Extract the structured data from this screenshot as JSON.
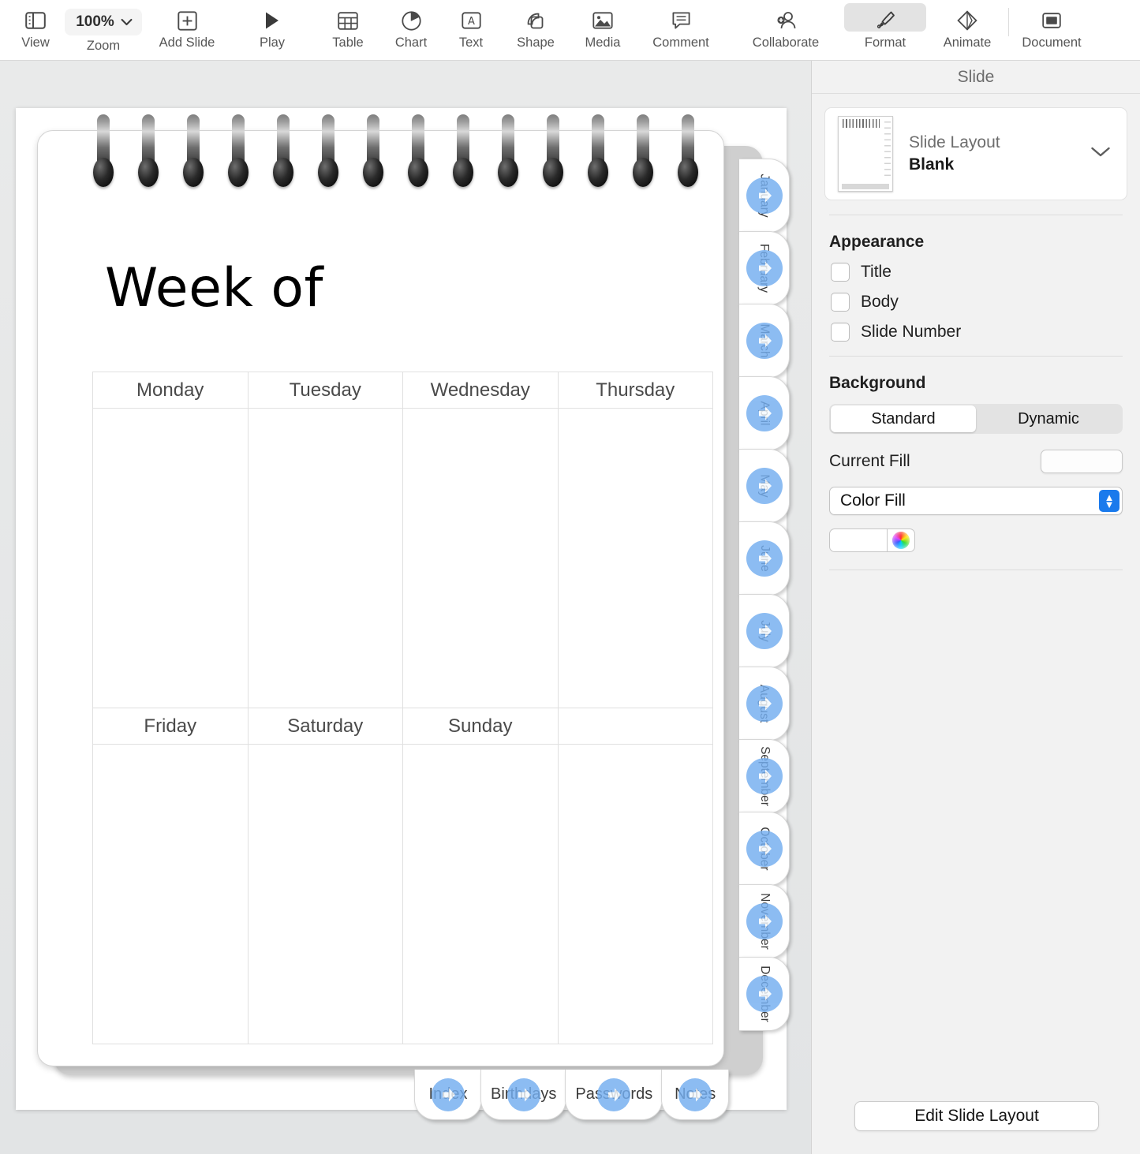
{
  "toolbar": {
    "items": [
      {
        "label": "View",
        "icon": "sidebar-icon",
        "type": "icon"
      },
      {
        "label": "Zoom",
        "icon": "chevron-down-icon",
        "type": "zoom",
        "value": "100%"
      },
      {
        "label": "Add Slide",
        "icon": "plus-square-icon",
        "type": "icon"
      },
      {
        "label": "Play",
        "icon": "play-triangle-icon",
        "type": "icon"
      },
      {
        "label": "Table",
        "icon": "table-grid-icon",
        "type": "icon"
      },
      {
        "label": "Chart",
        "icon": "pie-chart-icon",
        "type": "icon"
      },
      {
        "label": "Text",
        "icon": "text-box-icon",
        "type": "icon"
      },
      {
        "label": "Shape",
        "icon": "shapes-icon",
        "type": "icon"
      },
      {
        "label": "Media",
        "icon": "image-icon",
        "type": "icon"
      },
      {
        "label": "Comment",
        "icon": "comment-bubble-icon",
        "type": "icon"
      },
      {
        "label": "Collaborate",
        "icon": "add-person-icon",
        "type": "icon"
      },
      {
        "label": "Format",
        "icon": "paintbrush-icon",
        "type": "icon",
        "active": true
      },
      {
        "label": "Animate",
        "icon": "diamond-icon",
        "type": "icon"
      },
      {
        "label": "Document",
        "icon": "document-icon",
        "type": "icon"
      }
    ]
  },
  "slide": {
    "title": "Week of",
    "calendar": {
      "row1": [
        "Monday",
        "Tuesday",
        "Wednesday",
        "Thursday"
      ],
      "row1_cells": [
        "",
        "",
        "",
        ""
      ],
      "row2": [
        "Friday",
        "Saturday",
        "Sunday",
        ""
      ],
      "row2_cells": [
        "",
        "",
        "",
        ""
      ]
    },
    "month_tabs": [
      "January",
      "February",
      "March",
      "April",
      "May",
      "June",
      "July",
      "August",
      "September",
      "October",
      "November",
      "December"
    ],
    "bottom_tabs": [
      "Index",
      "Birthdays",
      "Passwords",
      "Notes"
    ],
    "link_icon": "arrow-right-circle-icon"
  },
  "sidebar": {
    "header": "Slide",
    "layout_card": {
      "caption": "Slide Layout",
      "value": "Blank",
      "chevron": "chevron-down-icon",
      "thumbnail": "notebook-thumbnail"
    },
    "appearance": {
      "title": "Appearance",
      "checkboxes": [
        {
          "label": "Title",
          "checked": false
        },
        {
          "label": "Body",
          "checked": false
        },
        {
          "label": "Slide Number",
          "checked": false
        }
      ]
    },
    "background": {
      "title": "Background",
      "segments": [
        {
          "label": "Standard",
          "selected": true
        },
        {
          "label": "Dynamic",
          "selected": false
        }
      ],
      "current_fill_label": "Current Fill",
      "current_fill_color": "#fdfdfd",
      "fill_type": "Color Fill",
      "color_value": "#ffffff",
      "color_wheel_icon": "color-wheel-icon",
      "stepper_icon": "up-down-stepper-icon"
    },
    "edit_layout_button": "Edit Slide Layout"
  },
  "colors": {
    "accent_blue": "#1a7aec",
    "link_blue": "#74aef0",
    "canvas_bg": "#e5e7e8",
    "sidebar_bg": "#f2f2f2",
    "toolbar_bg": "#ffffff"
  }
}
